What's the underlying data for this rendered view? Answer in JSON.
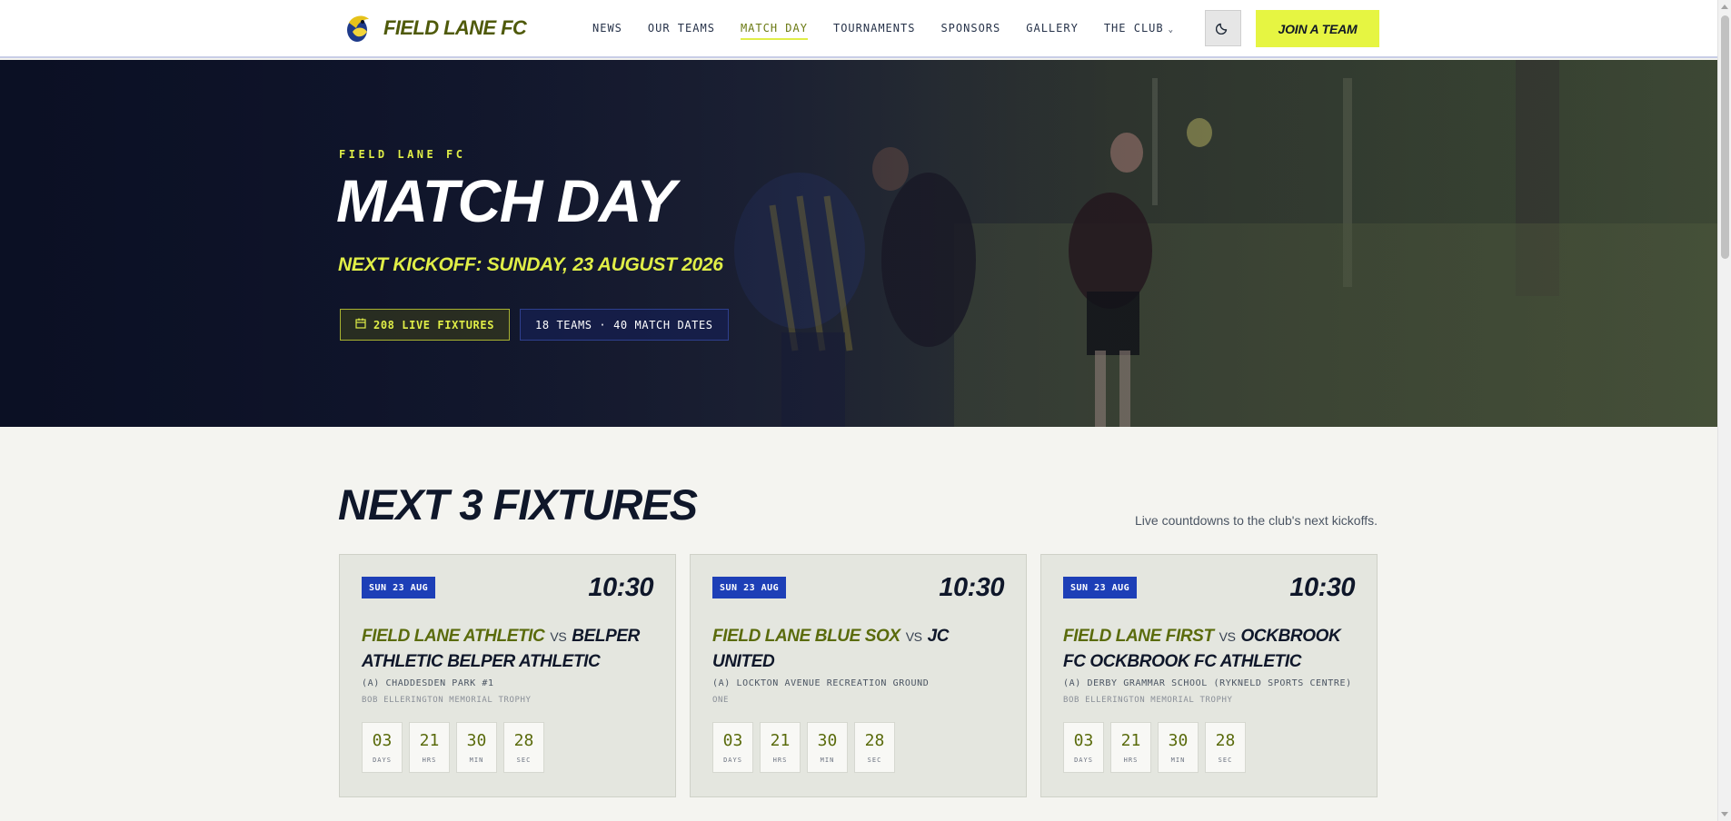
{
  "header": {
    "club_name": "FIELD LANE FC",
    "nav": [
      {
        "label": "NEWS"
      },
      {
        "label": "OUR TEAMS"
      },
      {
        "label": "MATCH DAY"
      },
      {
        "label": "TOURNAMENTS"
      },
      {
        "label": "SPONSORS"
      },
      {
        "label": "GALLERY"
      },
      {
        "label": "THE CLUB"
      }
    ],
    "active_nav": "MATCH DAY",
    "theme_icon": "moon-icon",
    "join_label": "JOIN A TEAM"
  },
  "hero": {
    "eyebrow": "FIELD LANE FC",
    "title": "MATCH DAY",
    "kickoff": "NEXT KICKOFF: SUNDAY, 23 AUGUST 2026",
    "live_fixtures": "208 LIVE FIXTURES",
    "teams_dates": "18 TEAMS · 40 MATCH DATES"
  },
  "fixtures_section": {
    "title": "NEXT 3 FIXTURES",
    "subtitle": "Live countdowns to the club's next kickoffs.",
    "countdown_labels": {
      "days": "DAYS",
      "hrs": "HRS",
      "min": "MIN",
      "sec": "SEC"
    },
    "cards": [
      {
        "date": "SUN 23 AUG",
        "time": "10:30",
        "home": "FIELD LANE ATHLETIC",
        "vs": "VS",
        "away": "BELPER ATHLETIC BELPER ATHLETIC",
        "venue": "(A) CHADDESDEN PARK #1",
        "competition": "BOB ELLERINGTON MEMORIAL TROPHY",
        "countdown": {
          "days": "03",
          "hrs": "21",
          "min": "30",
          "sec": "28"
        }
      },
      {
        "date": "SUN 23 AUG",
        "time": "10:30",
        "home": "FIELD LANE BLUE SOX",
        "vs": "VS",
        "away": "JC UNITED",
        "venue": "(A) LOCKTON AVENUE RECREATION GROUND",
        "competition": "ONE",
        "countdown": {
          "days": "03",
          "hrs": "21",
          "min": "30",
          "sec": "28"
        }
      },
      {
        "date": "SUN 23 AUG",
        "time": "10:30",
        "home": "FIELD LANE FIRST",
        "vs": "VS",
        "away": "OCKBROOK FC OCKBROOK FC ATHLETIC",
        "venue": "(A) DERBY GRAMMAR SCHOOL (RYKNELD SPORTS CENTRE)",
        "competition": "BOB ELLERINGTON MEMORIAL TROPHY",
        "countdown": {
          "days": "03",
          "hrs": "21",
          "min": "30",
          "sec": "28"
        }
      }
    ]
  },
  "colors": {
    "accent": "#e6f542",
    "brand_olive": "#5a6b0c",
    "navy": "#0f172a",
    "badge_blue": "#1d3fb7"
  }
}
